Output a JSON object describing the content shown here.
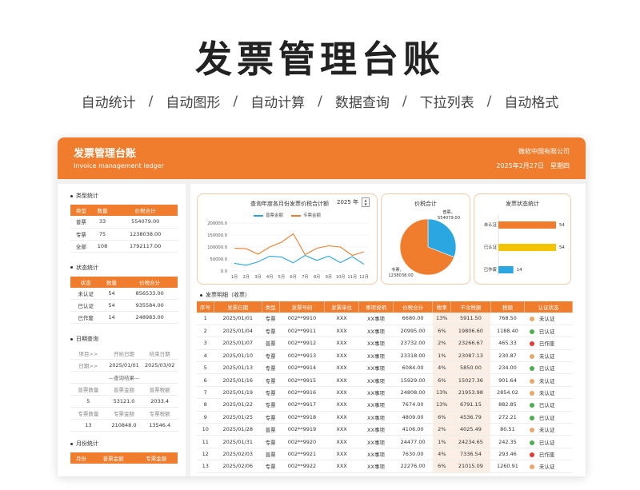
{
  "hero": {
    "title": "发票管理台账",
    "features": [
      "自动统计",
      "自动图形",
      "自动计算",
      "数据查询",
      "下拉列表",
      "自动格式"
    ],
    "separator": "/"
  },
  "app": {
    "title": "发票管理台账",
    "subtitle": "Invoice management ledger",
    "company": "微软中国有限公司",
    "date": "2025年2月27日",
    "weekday": "星期四"
  },
  "colors": {
    "accent": "#ef7d2d",
    "blue": "#2aa7e0",
    "yellow": "#f5c400",
    "tint": "#fbeee5"
  },
  "type_stats": {
    "title": "类型统计",
    "headers": [
      "类型",
      "数量",
      "价税合计"
    ],
    "rows": [
      [
        "普票",
        "33",
        "554079.00"
      ],
      [
        "专票",
        "75",
        "1238038.00"
      ],
      [
        "全部",
        "108",
        "1792117.00"
      ]
    ]
  },
  "status_stats": {
    "title": "状态统计",
    "headers": [
      "状态",
      "数量",
      "价税合计"
    ],
    "rows": [
      [
        "未认证",
        "54",
        "856533.00"
      ],
      [
        "已认证",
        "54",
        "935584.00"
      ],
      [
        "已作废",
        "14",
        "248983.00"
      ]
    ]
  },
  "date_query": {
    "title": "日期查询",
    "rows": [
      [
        "项目>>",
        "开始日期",
        "结束日期"
      ],
      [
        "日期>>",
        "2025/01/01",
        "2025/03/02"
      ]
    ],
    "result_label": "—查询结果—",
    "rows2": [
      [
        "普票数量",
        "普票金额",
        "普票税额"
      ],
      [
        "5",
        "53121.0",
        "2033.4"
      ],
      [
        "专票数量",
        "专票金额",
        "专票税额"
      ],
      [
        "13",
        "210848.0",
        "13546.4"
      ]
    ]
  },
  "monthly": {
    "title": "月份统计",
    "headers": [
      "月份",
      "普票金额",
      "专票金额"
    ]
  },
  "line_chart": {
    "title": "查询年度各月份发票价税合计额",
    "year": "2025",
    "year_unit": "年",
    "spin_up": "▲",
    "spin_down": "▼"
  },
  "chart_data": [
    {
      "type": "line",
      "title": "查询年度各月份发票价税合计额",
      "x": [
        "1月",
        "2月",
        "3月",
        "4月",
        "5月",
        "6月",
        "7月",
        "8月",
        "9月",
        "10月",
        "11月",
        "12月"
      ],
      "ylim": [
        0,
        200000
      ],
      "yticks": [
        "200000.0",
        "150000.0",
        "100000.0",
        "50000.0",
        "0.0"
      ],
      "series": [
        {
          "name": "普票金额",
          "color": "#2aa7e0",
          "values": [
            32000,
            24000,
            38000,
            62000,
            58000,
            34000,
            65000,
            44000,
            62000,
            35000,
            60000,
            28000
          ]
        },
        {
          "name": "专票金额",
          "color": "#ef7d2d",
          "values": [
            95000,
            93000,
            70000,
            100000,
            120000,
            155000,
            68000,
            95000,
            105000,
            100000,
            65000,
            80000
          ]
        }
      ]
    },
    {
      "type": "pie",
      "title": "价税合计",
      "slices": [
        {
          "name": "普票",
          "value": 554079.0,
          "label": "554079.00",
          "color": "#2aa7e0"
        },
        {
          "name": "专票",
          "value": 1238038.0,
          "label": "1238038.00",
          "color": "#ef7d2d"
        }
      ]
    },
    {
      "type": "bar",
      "title": "发票状态统计",
      "categories": [
        "未认证",
        "已认证",
        "已作废"
      ],
      "values": [
        54,
        54,
        14
      ],
      "colors": [
        "#ef7d2d",
        "#f5c400",
        "#2aa7e0"
      ],
      "xlim": [
        0,
        54
      ]
    }
  ],
  "detail": {
    "title": "发票明细（收票）",
    "headers": [
      "序号",
      "发票日期",
      "类型",
      "发票号码",
      "发票单位",
      "事项说明",
      "价税合计",
      "税率",
      "不含税额",
      "税额",
      "认证状态"
    ],
    "rows": [
      [
        "1",
        "2025/01/01",
        "专票",
        "002**9910",
        "XXX",
        "XX事项",
        "6680.00",
        "13%",
        "5911.50",
        "768.50",
        "未认证"
      ],
      [
        "2",
        "2025/01/04",
        "专票",
        "002**9911",
        "XXX",
        "XX事项",
        "20995.00",
        "6%",
        "19806.60",
        "1188.40",
        "已认证"
      ],
      [
        "3",
        "2025/01/07",
        "普票",
        "002**9912",
        "XXX",
        "XX事项",
        "23732.00",
        "2%",
        "23266.67",
        "465.33",
        "已作废"
      ],
      [
        "4",
        "2025/01/10",
        "专票",
        "002**9913",
        "XXX",
        "XX事项",
        "23318.00",
        "1%",
        "23087.13",
        "230.87",
        "未认证"
      ],
      [
        "5",
        "2025/01/13",
        "专票",
        "002**9914",
        "XXX",
        "XX事项",
        "6084.00",
        "4%",
        "5850.00",
        "234.00",
        "已认证"
      ],
      [
        "6",
        "2025/01/16",
        "专票",
        "002**9915",
        "XXX",
        "XX事项",
        "15929.00",
        "6%",
        "15027.36",
        "901.64",
        "未认证"
      ],
      [
        "7",
        "2025/01/19",
        "专票",
        "002**9916",
        "XXX",
        "XX事项",
        "24808.00",
        "13%",
        "21953.98",
        "2854.02",
        "未认证"
      ],
      [
        "8",
        "2025/01/22",
        "专票",
        "002**9917",
        "XXX",
        "XX事项",
        "7674.00",
        "13%",
        "6791.15",
        "882.85",
        "已认证"
      ],
      [
        "9",
        "2025/01/25",
        "专票",
        "002**9918",
        "XXX",
        "XX事项",
        "4809.00",
        "6%",
        "4536.79",
        "272.21",
        "已认证"
      ],
      [
        "10",
        "2025/01/28",
        "普票",
        "002**9919",
        "XXX",
        "XX事项",
        "4106.00",
        "2%",
        "4025.49",
        "80.51",
        "未认证"
      ],
      [
        "11",
        "2025/01/31",
        "专票",
        "002**9920",
        "XXX",
        "XX事项",
        "24477.00",
        "1%",
        "24234.65",
        "242.35",
        "已认证"
      ],
      [
        "12",
        "2025/02/03",
        "普票",
        "002**9921",
        "XXX",
        "XX事项",
        "7630.00",
        "4%",
        "7336.54",
        "293.46",
        "已作废"
      ],
      [
        "13",
        "2025/02/06",
        "专票",
        "002**9922",
        "XXX",
        "XX事项",
        "22276.00",
        "6%",
        "21015.09",
        "1260.91",
        "未认证"
      ]
    ],
    "status_colors": {
      "未认证": "#e8a86a",
      "已认证": "#4caf50",
      "已作废": "#e53935"
    }
  }
}
